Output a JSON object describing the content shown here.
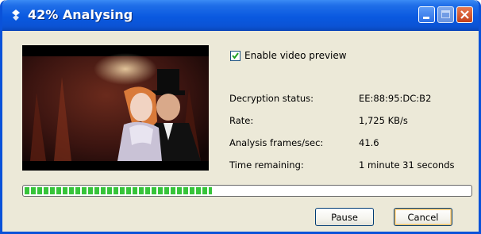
{
  "window": {
    "title": "42% Analysing",
    "colors": {
      "titlebar": "#0a59e0",
      "face": "#ece9d8",
      "progress": "#37c43a"
    }
  },
  "titlebar_buttons": {
    "minimize_icon": "minimize-icon",
    "maximize_icon": "maximize-icon",
    "close_icon": "close-icon"
  },
  "preview": {
    "enable_label": "Enable video preview",
    "enabled": true
  },
  "info": {
    "decryption_status": {
      "label": "Decryption status:",
      "value": "EE:88:95:DC:B2"
    },
    "rate": {
      "label": "Rate:",
      "value": "1,725 KB/s"
    },
    "frames": {
      "label": "Analysis frames/sec:",
      "value": "41.6"
    },
    "time_remaining": {
      "label": "Time remaining:",
      "value": "1 minute 31 seconds"
    }
  },
  "progress": {
    "percent": 42
  },
  "buttons": {
    "pause": "Pause",
    "cancel": "Cancel"
  }
}
